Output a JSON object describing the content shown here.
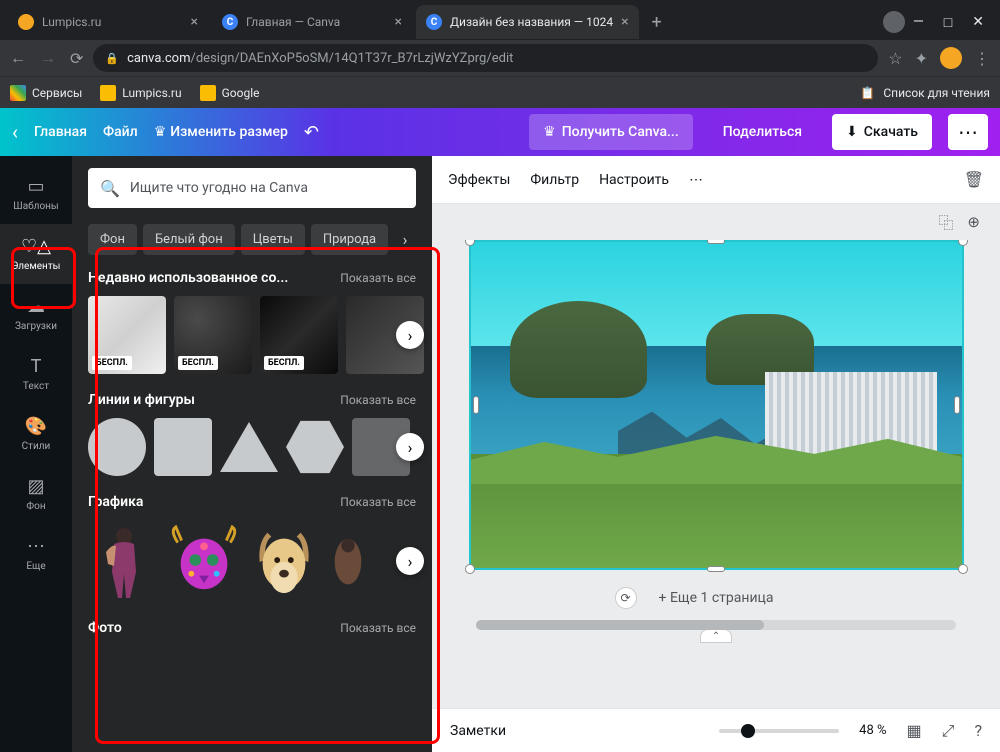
{
  "browser": {
    "tabs": [
      {
        "title": "Lumpics.ru",
        "favicon": "orange"
      },
      {
        "title": "Главная — Canva",
        "favicon": "blue"
      },
      {
        "title": "Дизайн без названия — 1024",
        "favicon": "blue",
        "active": true
      }
    ],
    "url_domain": "canva.com",
    "url_path": "/design/DAEnXoP5oSM/14Q1T37r_B7rLzjWzYZprg/edit",
    "bookmarks": {
      "apps": "Сервисы",
      "items": [
        "Lumpics.ru",
        "Google"
      ],
      "reading_list": "Список для чтения"
    }
  },
  "canva_top": {
    "home": "Главная",
    "file": "Файл",
    "resize": "Изменить размер",
    "get_pro": "Получить Canva...",
    "share": "Поделиться",
    "download": "Скачать"
  },
  "rail": {
    "templates": "Шаблоны",
    "elements": "Элементы",
    "uploads": "Загрузки",
    "text": "Текст",
    "styles": "Стили",
    "background": "Фон",
    "more": "Еще"
  },
  "panel": {
    "search_placeholder": "Ищите что угодно на Canva",
    "chips": [
      "Фон",
      "Белый фон",
      "Цветы",
      "Природа"
    ],
    "recent": {
      "title": "Недавно использованное со...",
      "all": "Показать все",
      "badge": "БЕСПЛ."
    },
    "shapes": {
      "title": "Линии и фигуры",
      "all": "Показать все"
    },
    "graphics": {
      "title": "Графика",
      "all": "Показать все"
    },
    "photo": {
      "title": "Фото",
      "all": "Показать все"
    }
  },
  "toolbar": {
    "effects": "Эффекты",
    "filter": "Фильтр",
    "adjust": "Настроить"
  },
  "canvas": {
    "add_page": "+ Еще 1 страница"
  },
  "footer": {
    "notes": "Заметки",
    "zoom": "48 %"
  }
}
